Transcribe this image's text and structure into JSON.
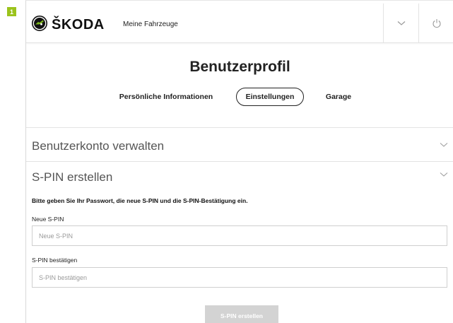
{
  "step_badge": "1",
  "header": {
    "brand": "ŠKODA",
    "my_vehicles_link": "Meine Fahrzeuge",
    "icons": {
      "logo": "skoda-winged-arrow-logo",
      "menu": "chevron-down-icon",
      "logout": "power-icon"
    }
  },
  "page": {
    "title": "Benutzerprofil",
    "tabs": [
      {
        "label": "Persönliche Informationen",
        "active": false
      },
      {
        "label": "Einstellungen",
        "active": true
      },
      {
        "label": "Garage",
        "active": false
      }
    ]
  },
  "sections": [
    {
      "title": "Benutzerkonto verwalten",
      "expanded": false
    },
    {
      "title": "S-PIN erstellen",
      "expanded": true,
      "instruction": "Bitte geben Sie Ihr Passwort, die neue S-PIN und die S-PIN-Bestätigung ein.",
      "fields": [
        {
          "label": "Neue S-PIN",
          "placeholder": "Neue S-PIN",
          "value": ""
        },
        {
          "label": "S-PIN bestätigen",
          "placeholder": "S-PIN bestätigen",
          "value": ""
        }
      ],
      "submit_label": "S-PIN erstellen"
    }
  ],
  "colors": {
    "badge": "#9bc31c",
    "button_disabled": "#d3d3d3",
    "border": "#e3e3e3"
  }
}
